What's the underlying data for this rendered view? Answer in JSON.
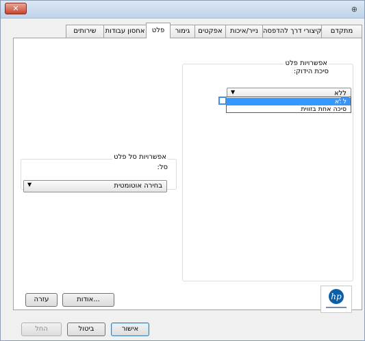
{
  "window": {
    "close_glyph": "✕",
    "help_glyph": "⊕"
  },
  "tabs": [
    "מתקדם",
    "קיצורי דרך להדפסה",
    "נייר/איכות",
    "אפקטים",
    "גימור",
    "פלט",
    "אחסון עבודות",
    "שירותים"
  ],
  "active_tab": "פלט",
  "output_options": {
    "title": "אפשרויות פלט",
    "staple_label": "סיכת הידוק:",
    "staple_value": "ללא",
    "staple_options": [
      "ללא",
      "סיכה אחת בזווית"
    ],
    "selected_option": "ללא"
  },
  "bin_options": {
    "title": "אפשרויות סל פלט",
    "bin_label": "סל:",
    "bin_value": "בחירה אוטומטית"
  },
  "panel_buttons": {
    "about": "אודות...",
    "help": "עזרה"
  },
  "dialog_buttons": {
    "ok": "אישור",
    "cancel": "ביטול",
    "apply": "החל"
  },
  "icons": {
    "close": "close-icon",
    "dropdown": "chevron-down-icon",
    "logo": "hp-logo",
    "preview": "document-preview-icon"
  },
  "colors": {
    "selection": "#3399ff",
    "close_button": "#c9442c",
    "hp_blue": "#0b5ea8"
  }
}
